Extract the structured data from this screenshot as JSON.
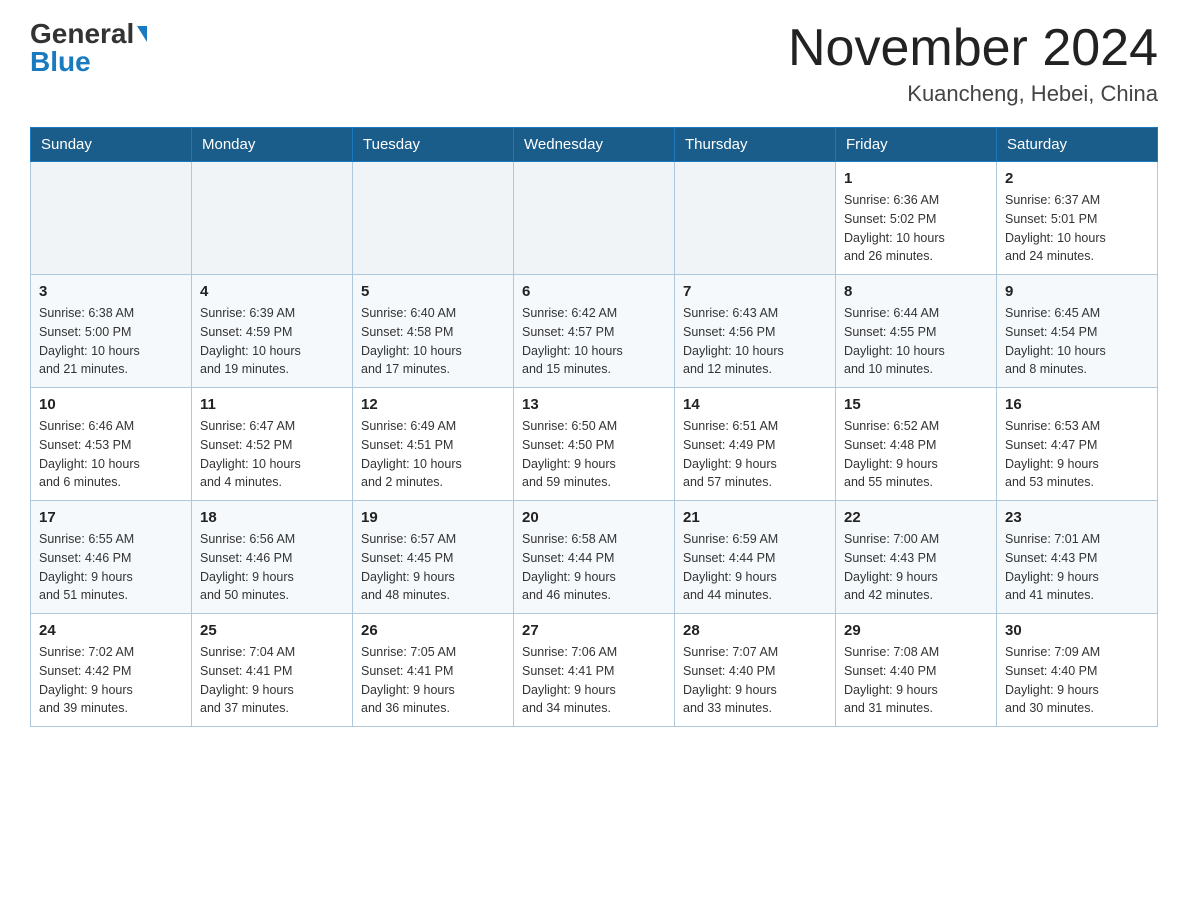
{
  "header": {
    "logo_general": "General",
    "logo_blue": "Blue",
    "month_title": "November 2024",
    "location": "Kuancheng, Hebei, China"
  },
  "weekdays": [
    "Sunday",
    "Monday",
    "Tuesday",
    "Wednesday",
    "Thursday",
    "Friday",
    "Saturday"
  ],
  "weeks": [
    {
      "days": [
        {
          "num": "",
          "info": ""
        },
        {
          "num": "",
          "info": ""
        },
        {
          "num": "",
          "info": ""
        },
        {
          "num": "",
          "info": ""
        },
        {
          "num": "",
          "info": ""
        },
        {
          "num": "1",
          "info": "Sunrise: 6:36 AM\nSunset: 5:02 PM\nDaylight: 10 hours\nand 26 minutes."
        },
        {
          "num": "2",
          "info": "Sunrise: 6:37 AM\nSunset: 5:01 PM\nDaylight: 10 hours\nand 24 minutes."
        }
      ]
    },
    {
      "days": [
        {
          "num": "3",
          "info": "Sunrise: 6:38 AM\nSunset: 5:00 PM\nDaylight: 10 hours\nand 21 minutes."
        },
        {
          "num": "4",
          "info": "Sunrise: 6:39 AM\nSunset: 4:59 PM\nDaylight: 10 hours\nand 19 minutes."
        },
        {
          "num": "5",
          "info": "Sunrise: 6:40 AM\nSunset: 4:58 PM\nDaylight: 10 hours\nand 17 minutes."
        },
        {
          "num": "6",
          "info": "Sunrise: 6:42 AM\nSunset: 4:57 PM\nDaylight: 10 hours\nand 15 minutes."
        },
        {
          "num": "7",
          "info": "Sunrise: 6:43 AM\nSunset: 4:56 PM\nDaylight: 10 hours\nand 12 minutes."
        },
        {
          "num": "8",
          "info": "Sunrise: 6:44 AM\nSunset: 4:55 PM\nDaylight: 10 hours\nand 10 minutes."
        },
        {
          "num": "9",
          "info": "Sunrise: 6:45 AM\nSunset: 4:54 PM\nDaylight: 10 hours\nand 8 minutes."
        }
      ]
    },
    {
      "days": [
        {
          "num": "10",
          "info": "Sunrise: 6:46 AM\nSunset: 4:53 PM\nDaylight: 10 hours\nand 6 minutes."
        },
        {
          "num": "11",
          "info": "Sunrise: 6:47 AM\nSunset: 4:52 PM\nDaylight: 10 hours\nand 4 minutes."
        },
        {
          "num": "12",
          "info": "Sunrise: 6:49 AM\nSunset: 4:51 PM\nDaylight: 10 hours\nand 2 minutes."
        },
        {
          "num": "13",
          "info": "Sunrise: 6:50 AM\nSunset: 4:50 PM\nDaylight: 9 hours\nand 59 minutes."
        },
        {
          "num": "14",
          "info": "Sunrise: 6:51 AM\nSunset: 4:49 PM\nDaylight: 9 hours\nand 57 minutes."
        },
        {
          "num": "15",
          "info": "Sunrise: 6:52 AM\nSunset: 4:48 PM\nDaylight: 9 hours\nand 55 minutes."
        },
        {
          "num": "16",
          "info": "Sunrise: 6:53 AM\nSunset: 4:47 PM\nDaylight: 9 hours\nand 53 minutes."
        }
      ]
    },
    {
      "days": [
        {
          "num": "17",
          "info": "Sunrise: 6:55 AM\nSunset: 4:46 PM\nDaylight: 9 hours\nand 51 minutes."
        },
        {
          "num": "18",
          "info": "Sunrise: 6:56 AM\nSunset: 4:46 PM\nDaylight: 9 hours\nand 50 minutes."
        },
        {
          "num": "19",
          "info": "Sunrise: 6:57 AM\nSunset: 4:45 PM\nDaylight: 9 hours\nand 48 minutes."
        },
        {
          "num": "20",
          "info": "Sunrise: 6:58 AM\nSunset: 4:44 PM\nDaylight: 9 hours\nand 46 minutes."
        },
        {
          "num": "21",
          "info": "Sunrise: 6:59 AM\nSunset: 4:44 PM\nDaylight: 9 hours\nand 44 minutes."
        },
        {
          "num": "22",
          "info": "Sunrise: 7:00 AM\nSunset: 4:43 PM\nDaylight: 9 hours\nand 42 minutes."
        },
        {
          "num": "23",
          "info": "Sunrise: 7:01 AM\nSunset: 4:43 PM\nDaylight: 9 hours\nand 41 minutes."
        }
      ]
    },
    {
      "days": [
        {
          "num": "24",
          "info": "Sunrise: 7:02 AM\nSunset: 4:42 PM\nDaylight: 9 hours\nand 39 minutes."
        },
        {
          "num": "25",
          "info": "Sunrise: 7:04 AM\nSunset: 4:41 PM\nDaylight: 9 hours\nand 37 minutes."
        },
        {
          "num": "26",
          "info": "Sunrise: 7:05 AM\nSunset: 4:41 PM\nDaylight: 9 hours\nand 36 minutes."
        },
        {
          "num": "27",
          "info": "Sunrise: 7:06 AM\nSunset: 4:41 PM\nDaylight: 9 hours\nand 34 minutes."
        },
        {
          "num": "28",
          "info": "Sunrise: 7:07 AM\nSunset: 4:40 PM\nDaylight: 9 hours\nand 33 minutes."
        },
        {
          "num": "29",
          "info": "Sunrise: 7:08 AM\nSunset: 4:40 PM\nDaylight: 9 hours\nand 31 minutes."
        },
        {
          "num": "30",
          "info": "Sunrise: 7:09 AM\nSunset: 4:40 PM\nDaylight: 9 hours\nand 30 minutes."
        }
      ]
    }
  ]
}
